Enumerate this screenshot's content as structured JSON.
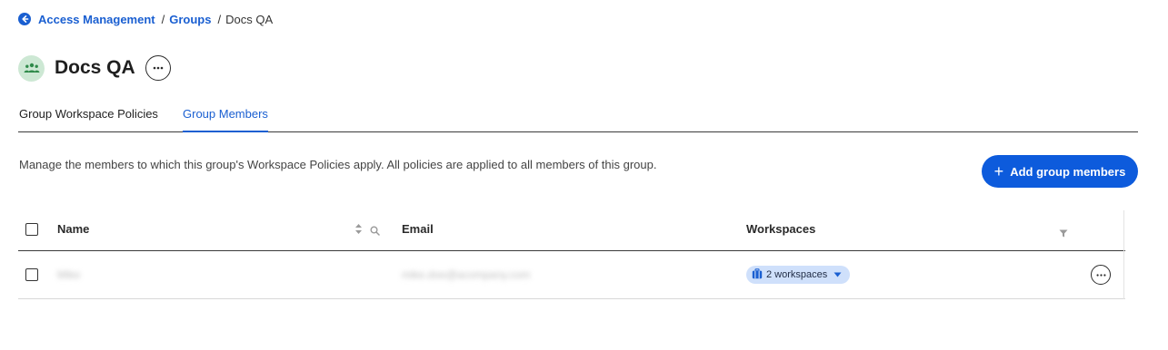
{
  "breadcrumb": {
    "icon": "back-arrow-icon",
    "items": [
      {
        "label": "Access Management"
      },
      {
        "label": "Groups"
      }
    ],
    "separator": "/",
    "current": "Docs QA"
  },
  "header": {
    "avatar_icon": "group-icon",
    "title": "Docs QA",
    "more_icon": "more-horizontal-icon"
  },
  "tabs": [
    {
      "label": "Group Workspace Policies",
      "active": false
    },
    {
      "label": "Group Members",
      "active": true
    }
  ],
  "description": "Manage the members to which this group's Workspace Policies apply. All policies are applied to all members of this group.",
  "add_button": {
    "icon": "plus-icon",
    "label": "Add group members"
  },
  "table": {
    "columns": [
      "Name",
      "Email",
      "Workspaces"
    ],
    "rows": [
      {
        "name": "Mike",
        "email": "mike.doe@acompany.com",
        "workspaces": "2 workspaces"
      }
    ]
  },
  "colors": {
    "accent": "#1a5fd1",
    "button_bg": "#0d5bdc",
    "avatar_bg": "#cde8d4",
    "badge_bg": "#cfe0fb"
  }
}
